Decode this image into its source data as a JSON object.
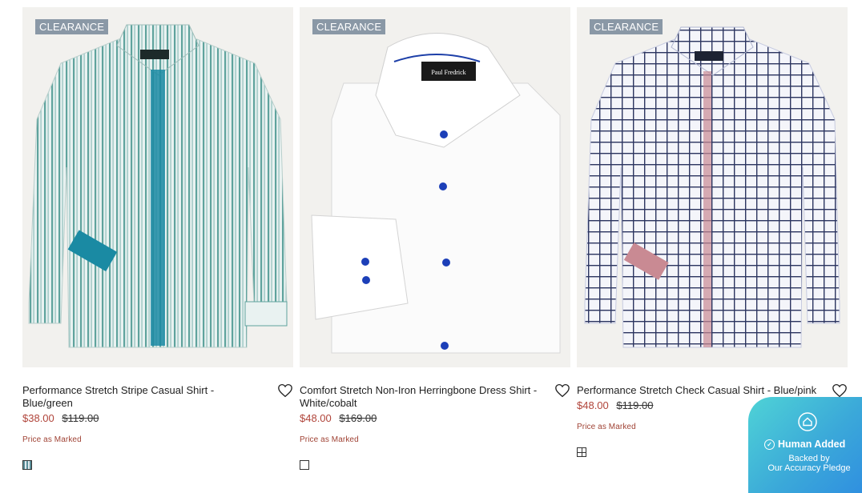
{
  "products": [
    {
      "badge": "CLEARANCE",
      "name": "Performance Stretch Stripe Casual Shirt - Blue/green",
      "sale_price": "$38.00",
      "original_price": "$119.00",
      "price_note": "Price as Marked",
      "swatch_icon": "stripe-swatch"
    },
    {
      "badge": "CLEARANCE",
      "name": "Comfort Stretch Non-Iron Herringbone Dress Shirt - White/cobalt",
      "sale_price": "$48.00",
      "original_price": "$169.00",
      "price_note": "Price as Marked",
      "swatch_icon": "solid-white-swatch",
      "label_text": "Paul Fredrick"
    },
    {
      "badge": "CLEARANCE",
      "name": "Performance Stretch Check Casual Shirt - Blue/pink",
      "sale_price": "$48.00",
      "original_price": "$119.00",
      "price_note": "Price as Marked",
      "swatch_icon": "check-swatch"
    }
  ],
  "pledge": {
    "title": "Human Added",
    "line1": "Backed by",
    "line2": "Our Accuracy Pledge"
  },
  "colors": {
    "badge_bg": "#8a98a6",
    "sale_price": "#b0443a",
    "pledge_gradient_start": "#4fd3d6",
    "pledge_gradient_end": "#2f8ee0"
  }
}
